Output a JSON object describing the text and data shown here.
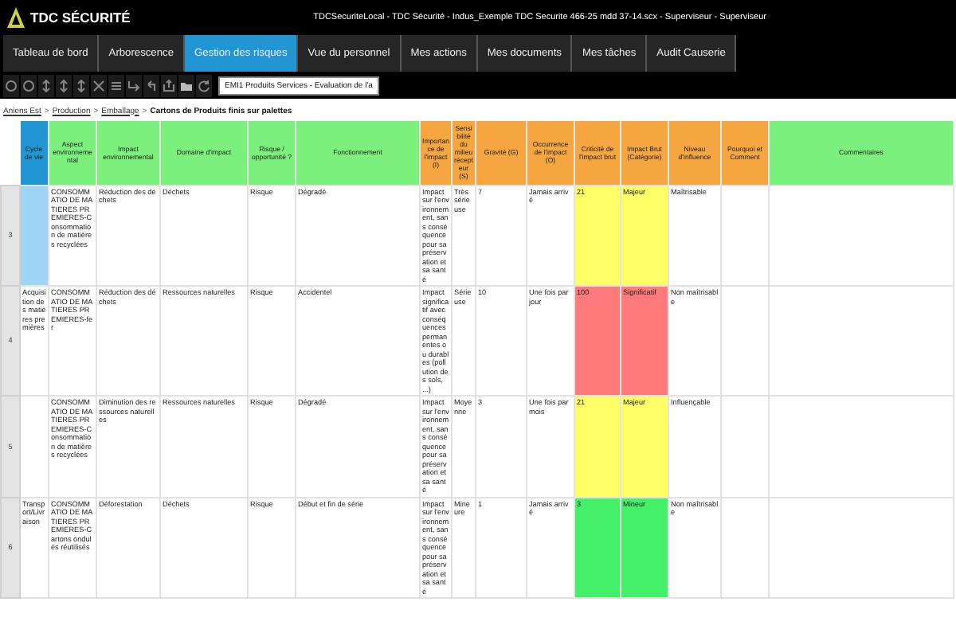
{
  "app": {
    "logo": "TDC SÉCURITÉ",
    "title": "TDCSecuriteLocal - TDC Sécurité - Indus_Exemple TDC Securite 466-25 mdd 37-14.scx - Superviseur - Superviseur"
  },
  "tabs": [
    {
      "label": "Tableau de bord",
      "selected": false
    },
    {
      "label": "Arborescence",
      "selected": false
    },
    {
      "label": "Gestion des risques",
      "selected": true
    },
    {
      "label": "Vue du personnel",
      "selected": false
    },
    {
      "label": "Mes actions",
      "selected": false
    },
    {
      "label": "Mes documents",
      "selected": false
    },
    {
      "label": "Mes tâches",
      "selected": false
    },
    {
      "label": "Audit Causerie",
      "selected": false
    }
  ],
  "toolbar": {
    "evaluation_field": {
      "value": "EMI1 Produits Services - Evaluation de l'a"
    }
  },
  "breadcrumb": [
    {
      "label": "Aniens Est",
      "kind": "link"
    },
    {
      "label": ">",
      "kind": "separator"
    },
    {
      "label": "Production",
      "kind": "link"
    },
    {
      "label": ">",
      "kind": "separator"
    },
    {
      "label": "Emballage",
      "kind": "link"
    },
    {
      "label": ">",
      "kind": "separator"
    },
    {
      "label": "Cartons de Produits finis sur palettes",
      "kind": "current"
    }
  ],
  "table": {
    "columns": [
      {
        "label": "Cycle de vie",
        "color": "#2196d3"
      },
      {
        "label": "Aspect environnemental",
        "color": "#7cf07c"
      },
      {
        "label": "Impact environnemental",
        "color": "#7cf07c"
      },
      {
        "label": "Domaine d'impact",
        "color": "#7cf07c"
      },
      {
        "label": "Risque / opportunité ?",
        "color": "#7cf07c"
      },
      {
        "label": "Fonctionnement",
        "color": "#7cf07c"
      },
      {
        "label": "Importance de l'impact (I)",
        "color": "#f5a640"
      },
      {
        "label": "Sensibilité du milieu récepteur (S)",
        "color": "#f5a640"
      },
      {
        "label": "Gravité (G)",
        "color": "#f5a640"
      },
      {
        "label": "Occurrence de l'impact (O)",
        "color": "#f5a640"
      },
      {
        "label": "Criticité de l'impact brut",
        "color": "#f5a640"
      },
      {
        "label": "Impact Brut (Catégorie)",
        "color": "#f5a640"
      },
      {
        "label": "Niveau d'influence",
        "color": "#f5a640"
      },
      {
        "label": "Pourquoi et Comment",
        "color": "#f5a640"
      },
      {
        "label": "Commentaires",
        "color": "#7cf07c"
      }
    ],
    "rows": [
      {
        "number": "3",
        "selected": true,
        "color": "#ffff66",
        "cells": [
          null,
          "CONSOMMATIO DE MATIERES PREMIERES-Consommation de matières recyclées",
          "Réduction des déchets",
          "Déchets",
          "Risque",
          "Dégradé",
          "Impact sur l'environnement, sans conséquence pour sa préservation et sa santé",
          "Très sérieuse",
          "7",
          "Jamais arrivé",
          "21",
          "Majeur",
          "Maîtrisable",
          null,
          null
        ]
      },
      {
        "number": "4",
        "selected": false,
        "color": "#ff7b7b",
        "cells": [
          "Acquisition des matières premières",
          "CONSOMMATIO DE MATIERES PREMIERES-fer",
          "Réduction des déchets",
          "Ressources naturelles",
          "Risque",
          "Accidentel",
          "Impact significatif avec conséquences permanentes ou durables (pollution des sols, ...)",
          "Sérieuse",
          "10",
          "Une fois par jour",
          "100",
          "Significatif",
          "Non maîtrisable",
          null,
          null
        ]
      },
      {
        "number": "5",
        "selected": false,
        "color": "#ffff66",
        "cells": [
          null,
          "CONSOMMATIO DE MATIERES PREMIERES-Consommation de matières recyclées",
          "Diminution des ressources naturelles",
          "Ressources naturelles",
          "Risque",
          "Dégradé",
          "Impact sur l'environnement, sans conséquence pour sa préservation et sa santé",
          "Moyenne",
          "3",
          "Une fois par mois",
          "21",
          "Majeur",
          "Influençable",
          null,
          null
        ]
      },
      {
        "number": "6",
        "selected": false,
        "color": "#44f06a",
        "cells": [
          "Transport/Livraison",
          "CONSOMMATIO DE MATIERES PREMIERES-Cartons ondulés réutilisés",
          "Déforestation",
          "Déchets",
          "Risque",
          "Début et fin de série",
          "Impact sur l'environnement, sans conséquence pour sa préservation et sa santé",
          "Mineure",
          "1",
          "Jamais arrivé",
          "3",
          "Mineur",
          "Non maîtrisable",
          null,
          null
        ]
      }
    ]
  }
}
